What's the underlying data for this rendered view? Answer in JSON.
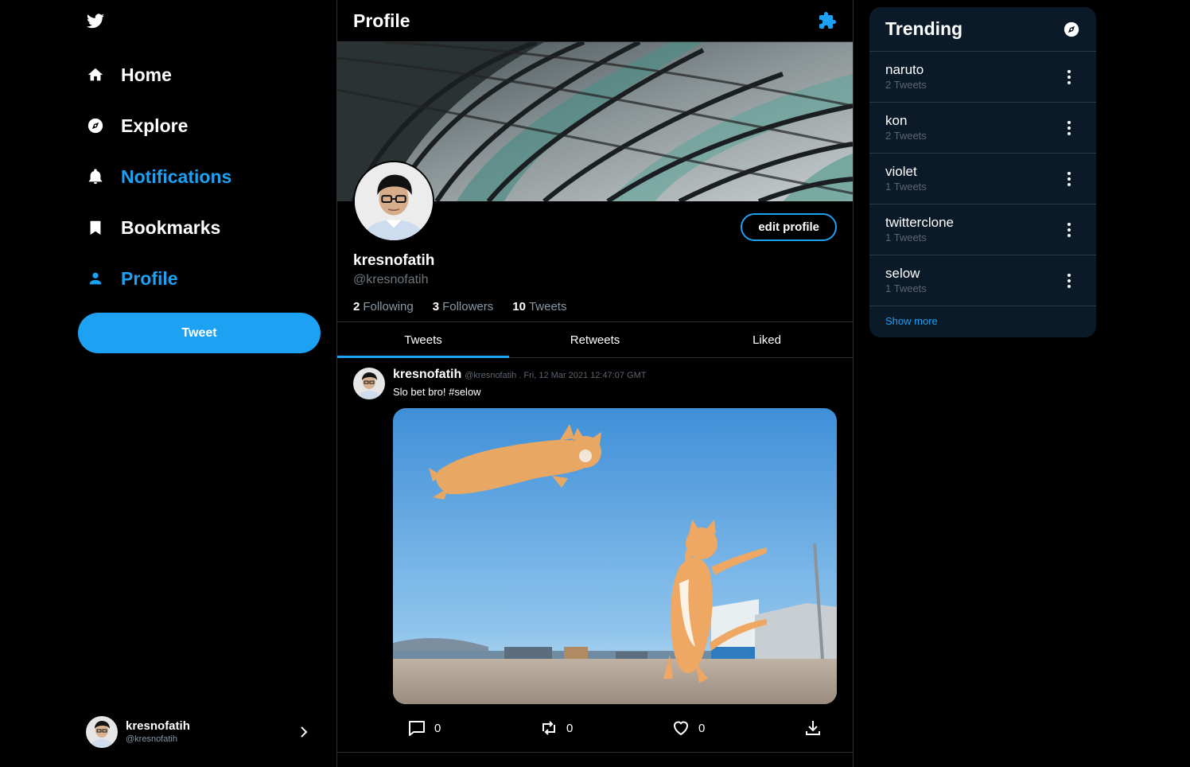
{
  "sidebar": {
    "items": [
      {
        "label": "Home",
        "icon": "home-icon",
        "active": false
      },
      {
        "label": "Explore",
        "icon": "compass-icon",
        "active": false
      },
      {
        "label": "Notifications",
        "icon": "bell-icon",
        "active": true
      },
      {
        "label": "Bookmarks",
        "icon": "bookmark-icon",
        "active": false
      },
      {
        "label": "Profile",
        "icon": "user-icon",
        "active": true
      }
    ],
    "tweet_label": "Tweet",
    "account": {
      "name": "kresnofatih",
      "handle": "@kresnofatih"
    }
  },
  "header": {
    "title": "Profile"
  },
  "profile": {
    "name": "kresnofatih",
    "handle": "@kresnofatih",
    "edit_label": "edit profile",
    "following_count": "2",
    "following_label": "Following",
    "followers_count": "3",
    "followers_label": "Followers",
    "tweets_count": "10",
    "tweets_label": "Tweets"
  },
  "tabs": [
    {
      "label": "Tweets",
      "active": true
    },
    {
      "label": "Retweets",
      "active": false
    },
    {
      "label": "Liked",
      "active": false
    }
  ],
  "tweet": {
    "name": "kresnofatih",
    "meta": "@kresnofatih . Fri, 12 Mar 2021 12:47:07 GMT",
    "text": "Slo bet bro! #selow",
    "replies": "0",
    "retweets": "0",
    "likes": "0"
  },
  "trending": {
    "title": "Trending",
    "items": [
      {
        "tag": "naruto",
        "count": "2 Tweets"
      },
      {
        "tag": "kon",
        "count": "2 Tweets"
      },
      {
        "tag": "violet",
        "count": "1 Tweets"
      },
      {
        "tag": "twitterclone",
        "count": "1 Tweets"
      },
      {
        "tag": "selow",
        "count": "1 Tweets"
      }
    ],
    "show_more": "Show more"
  },
  "colors": {
    "accent": "#1da1f2",
    "background": "#000000",
    "panel": "#0b1a28"
  }
}
